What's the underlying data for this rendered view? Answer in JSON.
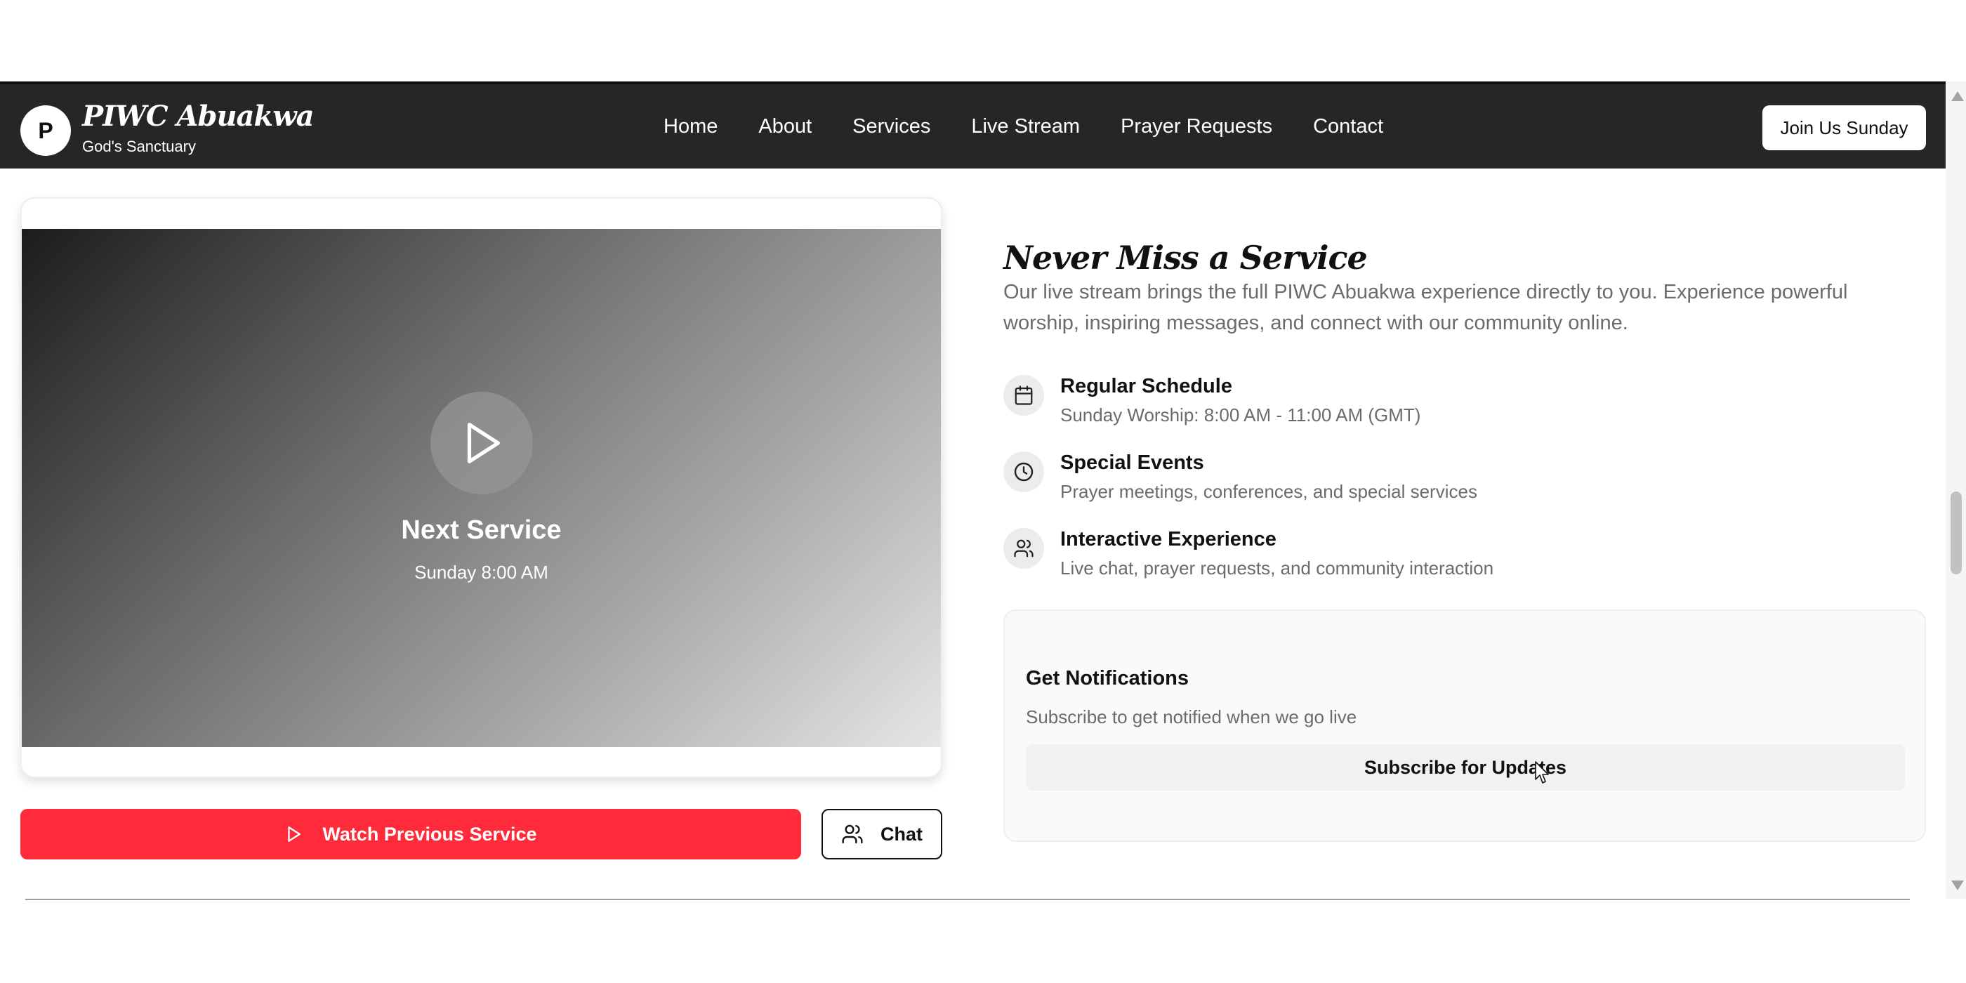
{
  "header": {
    "logo_letter": "P",
    "brand_title": "PIWC Abuakwa",
    "brand_subtitle": "God's Sanctuary",
    "nav": [
      {
        "label": "Home"
      },
      {
        "label": "About"
      },
      {
        "label": "Services"
      },
      {
        "label": "Live Stream"
      },
      {
        "label": "Prayer Requests"
      },
      {
        "label": "Contact"
      }
    ],
    "cta_label": "Join Us Sunday"
  },
  "video": {
    "title": "Next Service",
    "time": "Sunday 8:00 AM",
    "watch_label": "Watch Previous Service",
    "chat_label": "Chat"
  },
  "info": {
    "heading": "Never Miss a Service",
    "intro": "Our live stream brings the full PIWC Abuakwa experience directly to you. Experience powerful worship, inspiring messages, and connect with our community online.",
    "features": [
      {
        "icon": "calendar-icon",
        "title": "Regular Schedule",
        "desc": "Sunday Worship: 8:00 AM - 11:00 AM (GMT)"
      },
      {
        "icon": "clock-icon",
        "title": "Special Events",
        "desc": "Prayer meetings, conferences, and special services"
      },
      {
        "icon": "users-icon",
        "title": "Interactive Experience",
        "desc": "Live chat, prayer requests, and community interaction"
      }
    ]
  },
  "notifications": {
    "title": "Get Notifications",
    "desc": "Subscribe to get notified when we go live",
    "button_label": "Subscribe for Updates"
  },
  "colors": {
    "navbar_bg": "#262626",
    "accent_red": "#ff2a3a",
    "text_muted": "#6b6b6b"
  }
}
